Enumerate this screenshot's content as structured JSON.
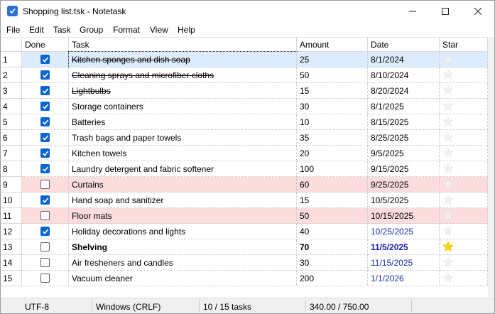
{
  "window": {
    "title": "Shopping list.tsk - Notetask"
  },
  "menu": [
    "File",
    "Edit",
    "Task",
    "Group",
    "Format",
    "View",
    "Help"
  ],
  "columns": {
    "done": "Done",
    "task": "Task",
    "amount": "Amount",
    "date": "Date",
    "star": "Star"
  },
  "rows": [
    {
      "num": "1",
      "done": true,
      "task": "Kitchen sponges and dish soap",
      "amount": "25",
      "date": "8/1/2024",
      "star": false,
      "style": "strike",
      "bg": "selected"
    },
    {
      "num": "2",
      "done": true,
      "task": "Cleaning sprays and microfiber cloths",
      "amount": "50",
      "date": "8/10/2024",
      "star": false,
      "style": "strike",
      "bg": ""
    },
    {
      "num": "3",
      "done": true,
      "task": "Lightbulbs",
      "amount": "15",
      "date": "8/20/2024",
      "star": false,
      "style": "strike",
      "bg": ""
    },
    {
      "num": "4",
      "done": true,
      "task": "Storage containers",
      "amount": "30",
      "date": "8/1/2025",
      "star": false,
      "style": "",
      "bg": ""
    },
    {
      "num": "5",
      "done": true,
      "task": "Batteries",
      "amount": "10",
      "date": "8/15/2025",
      "star": false,
      "style": "",
      "bg": ""
    },
    {
      "num": "6",
      "done": true,
      "task": "Trash bags and paper towels",
      "amount": "35",
      "date": "8/25/2025",
      "star": false,
      "style": "",
      "bg": ""
    },
    {
      "num": "7",
      "done": true,
      "task": "Kitchen towels",
      "amount": "20",
      "date": "9/5/2025",
      "star": false,
      "style": "",
      "bg": ""
    },
    {
      "num": "8",
      "done": true,
      "task": "Laundry detergent and fabric softener",
      "amount": "100",
      "date": "9/15/2025",
      "star": false,
      "style": "",
      "bg": ""
    },
    {
      "num": "9",
      "done": false,
      "task": "Curtains",
      "amount": "60",
      "date": "9/25/2025",
      "star": false,
      "style": "",
      "bg": "pink"
    },
    {
      "num": "10",
      "done": true,
      "task": "Hand soap and sanitizer",
      "amount": "15",
      "date": "10/5/2025",
      "star": false,
      "style": "",
      "bg": ""
    },
    {
      "num": "11",
      "done": false,
      "task": "Floor mats",
      "amount": "50",
      "date": "10/15/2025",
      "star": false,
      "style": "",
      "bg": "pink"
    },
    {
      "num": "12",
      "done": true,
      "task": "Holiday decorations and lights",
      "amount": "40",
      "date": "10/25/2025",
      "star": false,
      "style": "",
      "bg": "",
      "dateColor": "blue"
    },
    {
      "num": "13",
      "done": false,
      "task": "Shelving",
      "amount": "70",
      "date": "11/5/2025",
      "star": true,
      "style": "bold",
      "bg": "",
      "dateColor": "darkblue"
    },
    {
      "num": "14",
      "done": false,
      "task": "Air fresheners and candles",
      "amount": "30",
      "date": "11/15/2025",
      "star": false,
      "style": "",
      "bg": "",
      "dateColor": "blue"
    },
    {
      "num": "15",
      "done": false,
      "task": "Vacuum cleaner",
      "amount": "200",
      "date": "1/1/2026",
      "star": false,
      "style": "",
      "bg": "",
      "dateColor": "blue"
    }
  ],
  "status": {
    "encoding": "UTF-8",
    "line_endings": "Windows (CRLF)",
    "tasks": "10 / 15 tasks",
    "amount_total": "340.00 / 750.00"
  },
  "colors": {
    "selected_row": "#dcecfc",
    "pink_row": "#fcdcdc",
    "checkbox": "#0a64d2",
    "star_on": "#ffd400",
    "star_off": "#f1f1f1",
    "date_blue": "#1a2fa8"
  }
}
